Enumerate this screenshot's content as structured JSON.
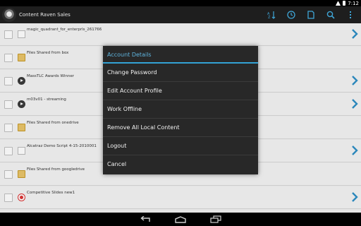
{
  "status": {
    "time": "7:12"
  },
  "app": {
    "title": "Content Raven Sales"
  },
  "actions": [
    "sort-icon",
    "history-icon",
    "document-icon",
    "search-icon",
    "overflow-menu-icon"
  ],
  "list": {
    "items": [
      {
        "name": "magic_quadrant_for_enterprls_261766",
        "icon": "document-icon",
        "chevron": true
      },
      {
        "name": "Files Shared from box",
        "icon": "folder-icon",
        "chevron": false
      },
      {
        "name": "MassTLC Awards Winner",
        "icon": "video-icon",
        "chevron": true
      },
      {
        "name": "m03v01 - streaming",
        "icon": "video-icon",
        "chevron": true
      },
      {
        "name": "Files Shared from onedrive",
        "icon": "folder-icon",
        "chevron": false
      },
      {
        "name": "Alcatraz Demo Script 4-15-2010001",
        "icon": "document-icon",
        "chevron": true
      },
      {
        "name": "Files Shared from googledrive",
        "icon": "folder-icon",
        "chevron": false
      },
      {
        "name": "Competitive Slides new1",
        "icon": "presentation-icon",
        "chevron": true
      }
    ]
  },
  "dialog": {
    "title": "Account Details",
    "items": [
      "Change Password",
      "Edit Account Profile",
      "Work Offline",
      "Remove All Local Content",
      "Logout",
      "Cancel"
    ]
  },
  "nav": [
    "back-icon",
    "home-icon",
    "recent-apps-icon"
  ],
  "colors": {
    "accent": "#33a2d4",
    "chevron": "#2e8fc6",
    "dialog_bg": "#282828",
    "actionbar_bg": "#1e1e1e"
  }
}
